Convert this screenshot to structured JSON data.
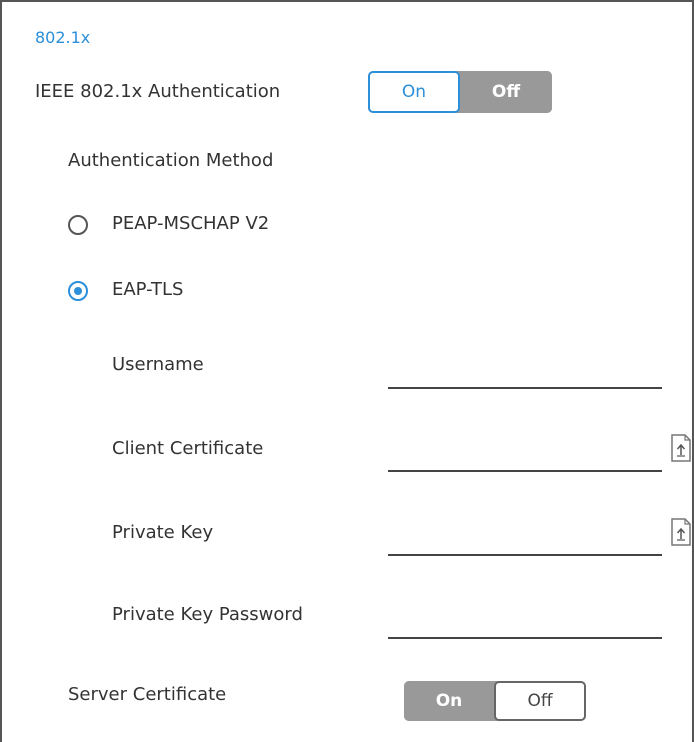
{
  "section_title": "802.1x",
  "ieee": {
    "label": "IEEE 802.1x Authentication",
    "on_label": "On",
    "off_label": "Off",
    "selected": "On"
  },
  "auth_method": {
    "label": "Authentication Method",
    "options": [
      {
        "label": "PEAP-MSCHAP V2",
        "selected": false
      },
      {
        "label": "EAP-TLS",
        "selected": true
      }
    ]
  },
  "fields": {
    "username": {
      "label": "Username",
      "value": ""
    },
    "client_certificate": {
      "label": "Client Certificate",
      "value": "",
      "icon": "upload-file-icon"
    },
    "private_key": {
      "label": "Private Key",
      "value": "",
      "icon": "upload-file-icon"
    },
    "private_key_password": {
      "label": "Private Key Password",
      "value": ""
    }
  },
  "server_certificate": {
    "label": "Server Certificate",
    "on_label": "On",
    "off_label": "Off",
    "selected": "Off"
  },
  "colors": {
    "accent": "#2b8fd9",
    "toggle_inactive": "#999999",
    "border": "#555555"
  }
}
